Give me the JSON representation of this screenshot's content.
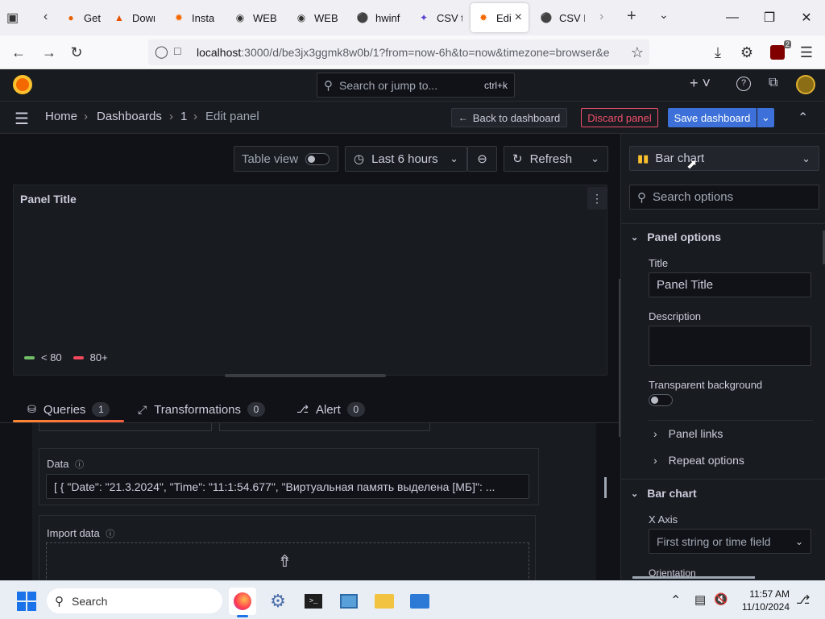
{
  "browser": {
    "tabs": [
      {
        "label": "Get st",
        "icon": "firefox-icon"
      },
      {
        "label": "Down",
        "icon": "flame-icon"
      },
      {
        "label": "Instal",
        "icon": "grafana-icon"
      },
      {
        "label": "WEB",
        "icon": "web-icon"
      },
      {
        "label": "WEB",
        "icon": "web-icon"
      },
      {
        "label": "hwinf",
        "icon": "github-icon"
      },
      {
        "label": "CSV t",
        "icon": "csv-icon"
      },
      {
        "label": "Edi",
        "icon": "grafana-icon",
        "active": true
      },
      {
        "label": "CSV E",
        "icon": "github-icon"
      }
    ],
    "url_host": "localhost",
    "url_rest": ":3000/d/be3jx3ggmk8w0b/1?from=now-6h&to=now&timezone=browser&e",
    "extension_badge": "2"
  },
  "grafana": {
    "search_placeholder": "Search or jump to...",
    "search_shortcut": "ctrl+k",
    "breadcrumb": [
      "Home",
      "Dashboards",
      "1",
      "Edit panel"
    ],
    "back_button": "Back to dashboard",
    "discard_button": "Discard panel",
    "save_button": "Save dashboard",
    "accent_blue": "#3d71d9",
    "accent_red": "#f0506e"
  },
  "toolbar": {
    "table_view": "Table view",
    "time_range": "Last 6 hours",
    "refresh": "Refresh"
  },
  "panel": {
    "title": "Panel Title",
    "legend": [
      {
        "label": "< 80",
        "color": "#73bf69"
      },
      {
        "label": "80+",
        "color": "#f2495c"
      }
    ]
  },
  "query_tabs": [
    {
      "label": "Queries",
      "count": "1"
    },
    {
      "label": "Transformations",
      "count": "0"
    },
    {
      "label": "Alert",
      "count": "0"
    }
  ],
  "query": {
    "data_label": "Data",
    "data_value": "[ { \"Date\": \"21.3.2024\", \"Time\": \"11:1:54.677\", \"Виртуальная память выделена [МБ]\": ...",
    "import_label": "Import data"
  },
  "options": {
    "visualization": "Bar chart",
    "search_placeholder": "Search options",
    "panel_options": "Panel options",
    "title_label": "Title",
    "title_value": "Panel Title",
    "description_label": "Description",
    "transparent_label": "Transparent background",
    "panel_links": "Panel links",
    "repeat_options": "Repeat options",
    "bar_chart_section": "Bar chart",
    "x_axis_label": "X Axis",
    "x_axis_placeholder": "First string or time field",
    "orientation_label": "Orientation"
  },
  "taskbar": {
    "search": "Search",
    "time": "11:57 AM",
    "date": "11/10/2024"
  }
}
